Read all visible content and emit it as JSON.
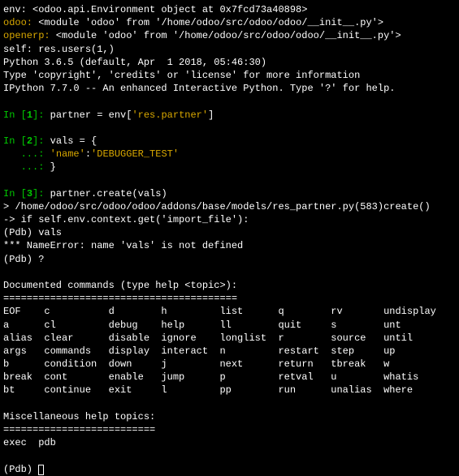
{
  "header": {
    "line1_pre": "env: <odoo.api.Environment object at 0x7fcd73a40898>",
    "line2_key": "odoo:",
    "line2_val": " <module 'odoo' from '/home/odoo/src/odoo/odoo/__init__.py'>",
    "line3_key": "openerp:",
    "line3_val": " <module 'odoo' from '/home/odoo/src/odoo/odoo/__init__.py'>",
    "line4_pre": "self: res.users(1,)",
    "line5": "Python 3.6.5 (default, Apr  1 2018, 05:46:30) ",
    "line6": "Type 'copyright', 'credits' or 'license' for more information",
    "line7": "IPython 7.7.0 -- An enhanced Interactive Python. Type '?' for help."
  },
  "in1": {
    "in": "In [",
    "num": "1",
    "close": "]:",
    "code_pre": " partner = env[",
    "code_str": "'res.partner'",
    "code_post": "]"
  },
  "in2": {
    "in": "In [",
    "num": "2",
    "close": "]:",
    "code": " vals = {",
    "cont1_dots": "   ...:",
    "cont1_key": " 'name'",
    "cont1_colon": ":",
    "cont1_val": "'DEBUGGER_TEST'",
    "cont2_dots": "   ...:",
    "cont2_code": " }"
  },
  "in3": {
    "in": "In [",
    "num": "3",
    "close": "]:",
    "code": " partner.create(vals)"
  },
  "pdb": {
    "trace": "> /home/odoo/src/odoo/odoo/addons/base/models/res_partner.py(583)create()",
    "src": "-> if self.env.context.get('import_file'):",
    "p1": "(Pdb) vals",
    "err": "*** NameError: name 'vals' is not defined",
    "p2": "(Pdb) ?"
  },
  "help": {
    "title": "Documented commands (type help <topic>):",
    "sep1": "========================================",
    "row1": "EOF    c          d        h         list      q        rv       undisplay",
    "row2": "a      cl         debug    help      ll        quit     s        unt      ",
    "row3": "alias  clear      disable  ignore    longlist  r        source   until    ",
    "row4": "args   commands   display  interact  n         restart  step     up       ",
    "row5": "b      condition  down     j         next      return   tbreak   w        ",
    "row6": "break  cont       enable   jump      p         retval   u        whatis   ",
    "row7": "bt     continue   exit     l         pp        run      unalias  where    ",
    "misc_title": "Miscellaneous help topics:",
    "sep2": "==========================",
    "misc_row": "exec  pdb"
  },
  "prompt_final": "(Pdb) "
}
